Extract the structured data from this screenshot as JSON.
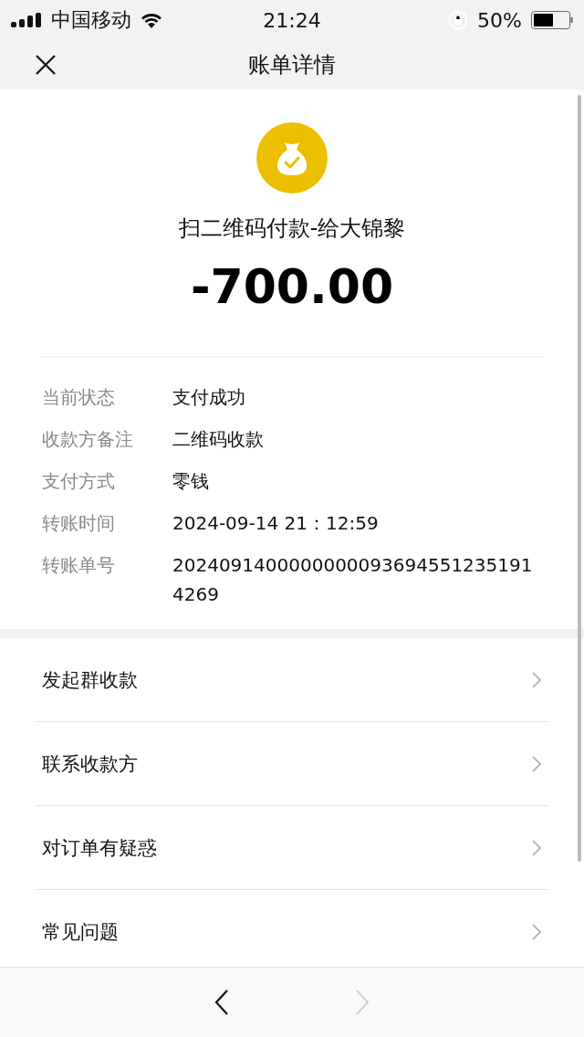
{
  "status_bar": {
    "carrier": "中国移动",
    "time": "21:24",
    "battery": "50%"
  },
  "nav_bar": {
    "title": "账单详情"
  },
  "summary": {
    "title": "扫二维码付款-给大锦黎",
    "amount": "-700.00"
  },
  "details": [
    {
      "label": "当前状态",
      "value": "支付成功"
    },
    {
      "label": "收款方备注",
      "value": "二维码收款"
    },
    {
      "label": "支付方式",
      "value": "零钱"
    },
    {
      "label": "转账时间",
      "value": "2024-09-14 21：12:59"
    },
    {
      "label": "转账单号",
      "value": "20240914000000000936945512351914269"
    }
  ],
  "actions": [
    {
      "label": "发起群收款"
    },
    {
      "label": "联系收款方"
    },
    {
      "label": "对订单有疑惑"
    },
    {
      "label": "常见问题"
    }
  ],
  "toolbar": {
    "back_disabled": false,
    "forward_disabled": true
  }
}
